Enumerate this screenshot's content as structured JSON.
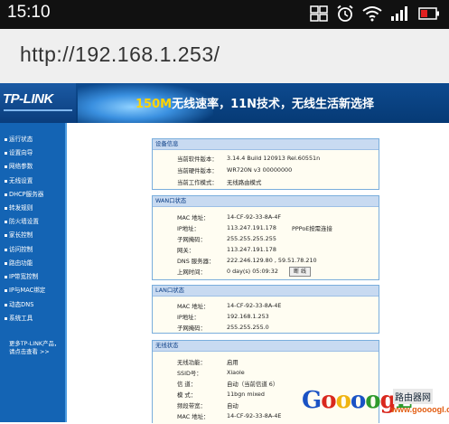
{
  "status_bar": {
    "time": "15:10",
    "icons": [
      "sim-icon",
      "alarm-icon",
      "wifi-icon",
      "signal-icon",
      "battery-icon"
    ]
  },
  "browser": {
    "url": "http://192.168.1.253/"
  },
  "banner": {
    "logo": "TP-LINK",
    "slogan_highlight": "150M",
    "slogan_rest": "无线速率，11N技术，无线生活新选择"
  },
  "sidebar": {
    "items": [
      {
        "label": "运行状态"
      },
      {
        "label": "设置向导"
      },
      {
        "label": "网络参数"
      },
      {
        "label": "无线设置"
      },
      {
        "label": "DHCP服务器"
      },
      {
        "label": "转发规则"
      },
      {
        "label": "防火墙设置"
      },
      {
        "label": "家长控制"
      },
      {
        "label": "访问控制"
      },
      {
        "label": "路由功能"
      },
      {
        "label": "IP带宽控制"
      },
      {
        "label": "IP与MAC绑定"
      },
      {
        "label": "动态DNS"
      },
      {
        "label": "系统工具"
      }
    ],
    "more_line1": "更多TP-LINK产品，",
    "more_line2": "请点击查看 >>"
  },
  "device_info": {
    "header": "设备信息",
    "rows": [
      {
        "label": "当前软件版本：",
        "value": "3.14.4 Build 120913 Rel.60551n"
      },
      {
        "label": "当前硬件版本：",
        "value": "WR720N v3 00000000"
      },
      {
        "label": "当前工作模式：",
        "value": "无线路由模式"
      }
    ]
  },
  "wan": {
    "header": "WAN口状态",
    "rows": [
      {
        "label": "MAC 地址：",
        "value": "14-CF-92-33-8A-4F"
      },
      {
        "label": "IP地址：",
        "value": "113.247.191.178",
        "extra": "PPPoE按需连接"
      },
      {
        "label": "子网掩码：",
        "value": "255.255.255.255"
      },
      {
        "label": "网关：",
        "value": "113.247.191.178"
      },
      {
        "label": "DNS 服务器：",
        "value": "222.246.129.80 , 59.51.78.210"
      },
      {
        "label": "上网时间：",
        "value": "0 day(s) 05:09:32"
      }
    ],
    "disconnect_button": "断 线"
  },
  "lan": {
    "header": "LAN口状态",
    "rows": [
      {
        "label": "MAC 地址：",
        "value": "14-CF-92-33-8A-4E"
      },
      {
        "label": "IP地址：",
        "value": "192.168.1.253"
      },
      {
        "label": "子网掩码：",
        "value": "255.255.255.0"
      }
    ]
  },
  "wireless": {
    "header": "无线状态",
    "rows": [
      {
        "label": "无线功能：",
        "value": "启用"
      },
      {
        "label": "SSID号：",
        "value": "Xiaole"
      },
      {
        "label": "信 道：",
        "value": "自动（当前信道 6）"
      },
      {
        "label": "模 式：",
        "value": "11bgn mixed"
      },
      {
        "label": "频段带宽：",
        "value": "自动"
      },
      {
        "label": "MAC 地址：",
        "value": "14-CF-92-33-8A-4E"
      }
    ]
  },
  "watermark": {
    "brand": "GoooogL",
    "site_cn": "路由器网",
    "site_url": "www.goooogl.com",
    "colors": [
      "#1a52c4",
      "#d9281e",
      "#f0b410",
      "#1a52c4",
      "#2e9a2c",
      "#d9281e",
      "#2e9a2c"
    ]
  }
}
